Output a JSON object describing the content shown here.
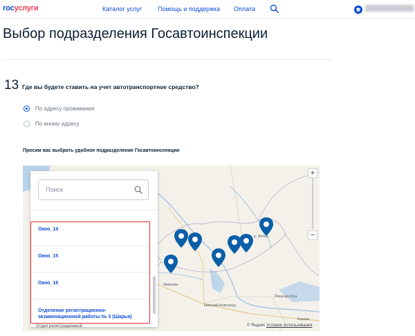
{
  "header": {
    "logo_part1": "гос",
    "logo_part2": "услуги",
    "nav": [
      "Каталог услуг",
      "Помощь и поддержка",
      "Оплата"
    ],
    "search_icon": "search-icon",
    "user_icon": "user-icon"
  },
  "page": {
    "title": "Выбор подразделения Госавтоинспекции"
  },
  "question": {
    "number": "13",
    "text": "Где вы будете ставить на учет автотранспортное средство?",
    "options": [
      {
        "label": "По адресу проживания",
        "checked": true
      },
      {
        "label": "По иному адресу",
        "checked": false
      }
    ]
  },
  "subhead": "Просим вас выбрать удобное подразделение Госавтоинспекции",
  "panel": {
    "search_placeholder": "Поиск",
    "items": [
      "Окно_14",
      "Окно_15",
      "Окно_16",
      "Отделение регистрационно-экзаменационной работы № 3 (Шарья)"
    ],
    "overflow_text": "Отдел регистрационной"
  },
  "map": {
    "zoom_in": "+",
    "zoom_out": "−",
    "labels": [
      "Иваново",
      "Нижний Новгород",
      "Йошкар-Ола",
      "Казань",
      "р. Вятка"
    ],
    "copyright_prefix": "© Яндекс",
    "copyright_link": "Условия использования",
    "pin_color": "#0a5fa8"
  },
  "colors": {
    "accent": "#0d4cd3",
    "highlight_frame": "#e22b2b"
  }
}
